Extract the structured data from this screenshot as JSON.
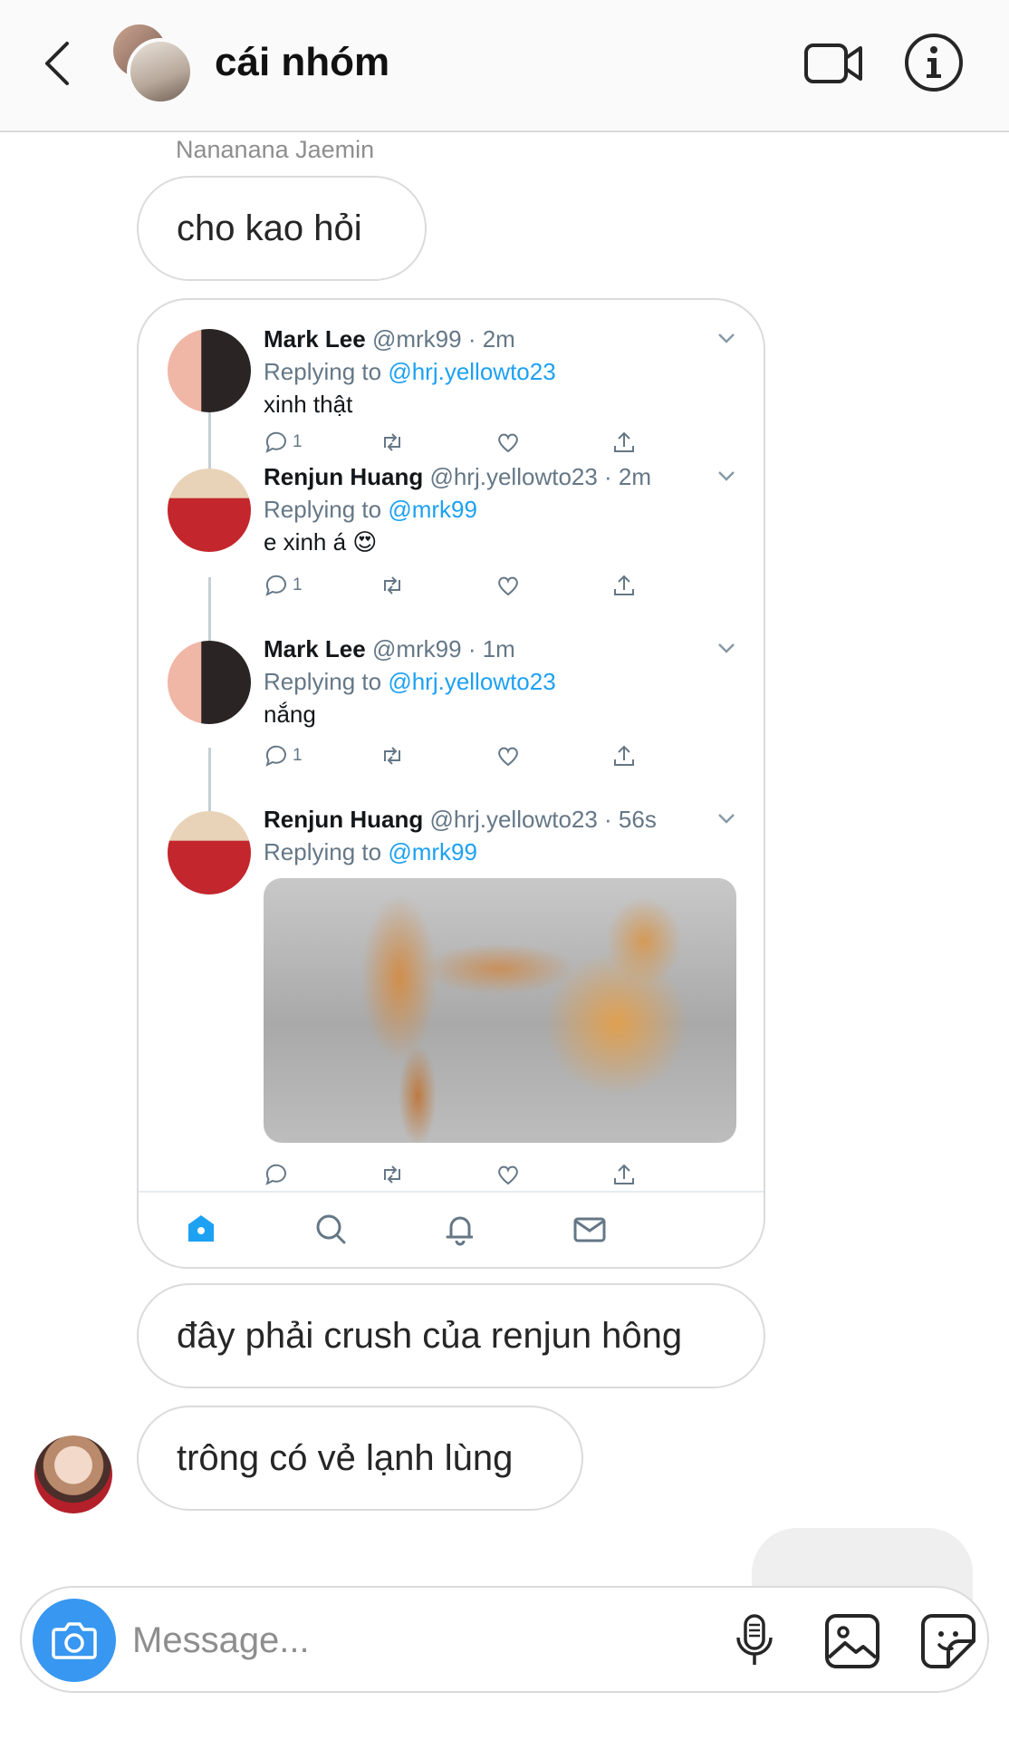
{
  "header": {
    "title": "cái nhóm",
    "icons": [
      "back-chevron-icon",
      "video-call-icon",
      "info-icon"
    ]
  },
  "messages": {
    "sender_name": "Nanananа Jaemin",
    "bubble_1": "cho kao hỏi",
    "bubble_2": "đây phải crush của renjun hông",
    "bubble_3": "trông có vẻ lạnh lùng"
  },
  "shared_post": {
    "tweets": [
      {
        "name": "Mark Lee",
        "handle": "@mrk99 · 2m",
        "replying_prefix": "Replying to ",
        "replying_to": "@hrj.yellowto23",
        "text": "xinh thật",
        "reply_count": "1"
      },
      {
        "name": "Renjun Huang",
        "handle": "@hrj.yellowto23 · 2m",
        "replying_prefix": "Replying to ",
        "replying_to": "@mrk99",
        "text": "e xinh á 😍",
        "reply_count": "1"
      },
      {
        "name": "Mark Lee",
        "handle": "@mrk99 · 1m",
        "replying_prefix": "Replying to ",
        "replying_to": "@hrj.yellowto23",
        "text": "nắng",
        "reply_count": "1"
      },
      {
        "name": "Renjun Huang",
        "handle": "@hrj.yellowto23 · 56s",
        "replying_prefix": "Replying to ",
        "replying_to": "@mrk99",
        "text": "",
        "reply_count": ""
      }
    ],
    "tab_icons": [
      "home-icon",
      "search-icon",
      "notifications-bell-icon",
      "messages-mail-icon"
    ],
    "colors": {
      "accent": "#1da1f2",
      "muted": "#657786"
    }
  },
  "composer": {
    "placeholder": "Message...",
    "icons": [
      "camera-icon",
      "microphone-icon",
      "gallery-icon",
      "sticker-icon"
    ],
    "accent": "#3897f0"
  }
}
